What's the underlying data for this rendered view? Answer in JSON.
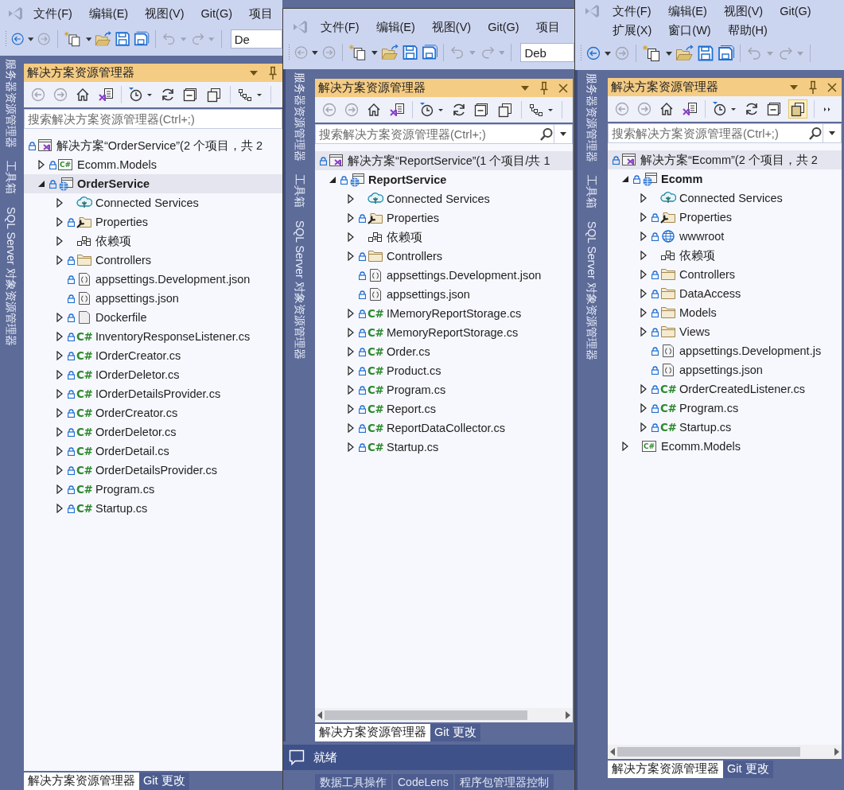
{
  "windows": [
    {
      "menu_rows": [
        [
          "文件(F)",
          "编辑(E)",
          "视图(V)",
          "Git(G)",
          "项目"
        ]
      ],
      "back_enabled": true,
      "config_combo": "De",
      "side_tabs": [
        "服务器资源管理器",
        "工具箱",
        "SQL Server 对象资源管理器"
      ],
      "explorer": {
        "title": "解决方案资源管理器",
        "closable": false,
        "toolbar": [
          {
            "kind": "back"
          },
          {
            "kind": "forward"
          },
          {
            "kind": "home"
          },
          {
            "kind": "switch-views"
          },
          {
            "kind": "sep"
          },
          {
            "kind": "pending-filter"
          },
          {
            "kind": "refresh"
          },
          {
            "kind": "collapse-all"
          },
          {
            "kind": "show-all"
          },
          {
            "kind": "sep"
          },
          {
            "kind": "hierarchy"
          },
          {
            "kind": "sep"
          }
        ],
        "show_all_files": false,
        "search_placeholder": "搜索解决方案资源管理器(Ctrl+;)",
        "search_button": false,
        "tree": [
          {
            "label": "解决方案“OrderService”(2 个项目，共 2",
            "kind": "solution",
            "locked": true,
            "selected": false,
            "children": [
              {
                "label": "Ecomm.Models",
                "kind": "csharp-project",
                "icon_text": "C#",
                "locked": true,
                "expanded": false,
                "selected": false
              },
              {
                "label": "OrderService",
                "kind": "web-project",
                "locked": true,
                "expanded": true,
                "selected": true,
                "children": [
                  {
                    "label": "Connected Services",
                    "kind": "connected",
                    "locked": false,
                    "expanded": false,
                    "selected": false
                  },
                  {
                    "label": "Properties",
                    "kind": "properties",
                    "locked": true,
                    "expanded": false,
                    "selected": false
                  },
                  {
                    "label": "依赖项",
                    "kind": "dependencies",
                    "locked": false,
                    "expanded": false,
                    "selected": false
                  },
                  {
                    "label": "Controllers",
                    "kind": "folder",
                    "locked": true,
                    "expanded": false,
                    "selected": false
                  },
                  {
                    "label": "appsettings.Development.json",
                    "kind": "json",
                    "locked": true,
                    "selected": false
                  },
                  {
                    "label": "appsettings.json",
                    "kind": "json",
                    "locked": true,
                    "selected": false
                  },
                  {
                    "label": "Dockerfile",
                    "kind": "file",
                    "locked": true,
                    "expanded": false,
                    "selected": false
                  },
                  {
                    "label": "InventoryResponseListener.cs",
                    "kind": "csharp",
                    "icon_text": "C#",
                    "locked": true,
                    "expanded": false,
                    "selected": false
                  },
                  {
                    "label": "IOrderCreator.cs",
                    "kind": "csharp",
                    "icon_text": "C#",
                    "locked": true,
                    "expanded": false,
                    "selected": false
                  },
                  {
                    "label": "IOrderDeletor.cs",
                    "kind": "csharp",
                    "icon_text": "C#",
                    "locked": true,
                    "expanded": false,
                    "selected": false
                  },
                  {
                    "label": "IOrderDetailsProvider.cs",
                    "kind": "csharp",
                    "icon_text": "C#",
                    "locked": true,
                    "expanded": false,
                    "selected": false
                  },
                  {
                    "label": "OrderCreator.cs",
                    "kind": "csharp",
                    "icon_text": "C#",
                    "locked": true,
                    "expanded": false,
                    "selected": false
                  },
                  {
                    "label": "OrderDeletor.cs",
                    "kind": "csharp",
                    "icon_text": "C#",
                    "locked": true,
                    "expanded": false,
                    "selected": false
                  },
                  {
                    "label": "OrderDetail.cs",
                    "kind": "csharp",
                    "icon_text": "C#",
                    "locked": true,
                    "expanded": false,
                    "selected": false
                  },
                  {
                    "label": "OrderDetailsProvider.cs",
                    "kind": "csharp",
                    "icon_text": "C#",
                    "locked": true,
                    "expanded": false,
                    "selected": false
                  },
                  {
                    "label": "Program.cs",
                    "kind": "csharp",
                    "icon_text": "C#",
                    "locked": true,
                    "expanded": false,
                    "selected": false
                  },
                  {
                    "label": "Startup.cs",
                    "kind": "csharp",
                    "icon_text": "C#",
                    "locked": true,
                    "expanded": false,
                    "selected": false
                  }
                ]
              }
            ]
          }
        ],
        "scrollbar": false,
        "tabs": [
          {
            "label": "解决方案资源管理器",
            "selected": true
          },
          {
            "label": "Git 更改",
            "selected": false
          }
        ]
      }
    },
    {
      "menu_rows": [
        [
          "文件(F)",
          "编辑(E)",
          "视图(V)",
          "Git(G)",
          "项目"
        ]
      ],
      "back_enabled": false,
      "config_combo": "Deb",
      "side_tabs": [
        "服务器资源管理器",
        "工具箱",
        "SQL Server 对象资源管理器"
      ],
      "explorer": {
        "title": "解决方案资源管理器",
        "closable": true,
        "toolbar": [
          {
            "kind": "back"
          },
          {
            "kind": "forward"
          },
          {
            "kind": "home"
          },
          {
            "kind": "switch-views"
          },
          {
            "kind": "sep"
          },
          {
            "kind": "pending-filter"
          },
          {
            "kind": "refresh"
          },
          {
            "kind": "collapse-all"
          },
          {
            "kind": "show-all"
          },
          {
            "kind": "sep"
          },
          {
            "kind": "hierarchy"
          },
          {
            "kind": "sep"
          }
        ],
        "show_all_files": false,
        "search_placeholder": "搜索解决方案资源管理器(Ctrl+;)",
        "search_button": true,
        "tree": [
          {
            "label": "解决方案“ReportService”(1 个项目/共 1",
            "kind": "solution",
            "locked": true,
            "selected": true,
            "children": [
              {
                "label": "ReportService",
                "kind": "web-project",
                "locked": true,
                "expanded": true,
                "selected": false,
                "children": [
                  {
                    "label": "Connected Services",
                    "kind": "connected",
                    "locked": false,
                    "expanded": false,
                    "selected": false
                  },
                  {
                    "label": "Properties",
                    "kind": "properties",
                    "locked": true,
                    "expanded": false,
                    "selected": false
                  },
                  {
                    "label": "依赖项",
                    "kind": "dependencies",
                    "locked": false,
                    "expanded": false,
                    "selected": false
                  },
                  {
                    "label": "Controllers",
                    "kind": "folder",
                    "locked": true,
                    "expanded": false,
                    "selected": false
                  },
                  {
                    "label": "appsettings.Development.json",
                    "kind": "json",
                    "locked": true,
                    "selected": false
                  },
                  {
                    "label": "appsettings.json",
                    "kind": "json",
                    "locked": true,
                    "selected": false
                  },
                  {
                    "label": "IMemoryReportStorage.cs",
                    "kind": "csharp",
                    "icon_text": "C#",
                    "locked": true,
                    "expanded": false,
                    "selected": false
                  },
                  {
                    "label": "MemoryReportStorage.cs",
                    "kind": "csharp",
                    "icon_text": "C#",
                    "locked": true,
                    "expanded": false,
                    "selected": false
                  },
                  {
                    "label": "Order.cs",
                    "kind": "csharp",
                    "icon_text": "C#",
                    "locked": true,
                    "expanded": false,
                    "selected": false
                  },
                  {
                    "label": "Product.cs",
                    "kind": "csharp",
                    "icon_text": "C#",
                    "locked": true,
                    "expanded": false,
                    "selected": false
                  },
                  {
                    "label": "Program.cs",
                    "kind": "csharp",
                    "icon_text": "C#",
                    "locked": true,
                    "expanded": false,
                    "selected": false
                  },
                  {
                    "label": "Report.cs",
                    "kind": "csharp",
                    "icon_text": "C#",
                    "locked": true,
                    "expanded": false,
                    "selected": false
                  },
                  {
                    "label": "ReportDataCollector.cs",
                    "kind": "csharp",
                    "icon_text": "C#",
                    "locked": true,
                    "expanded": false,
                    "selected": false
                  },
                  {
                    "label": "Startup.cs",
                    "kind": "csharp",
                    "icon_text": "C#",
                    "locked": true,
                    "expanded": false,
                    "selected": false
                  }
                ]
              }
            ]
          }
        ],
        "scrollbar": true,
        "tabs": [
          {
            "label": "解决方案资源管理器",
            "selected": true
          },
          {
            "label": "Git 更改",
            "selected": false
          }
        ]
      },
      "status_bar": {
        "text": "就绪"
      },
      "tool_tabs": [
        "数据工具操作",
        "CodeLens",
        "程序包管理器控制"
      ]
    },
    {
      "menu_rows": [
        [
          "文件(F)",
          "编辑(E)",
          "视图(V)",
          "Git(G)"
        ],
        [
          "扩展(X)",
          "窗口(W)",
          "帮助(H)"
        ]
      ],
      "back_enabled": true,
      "side_tabs": [
        "服务器资源管理器",
        "工具箱",
        "SQL Server 对象资源管理器"
      ],
      "explorer": {
        "title": "解决方案资源管理器",
        "closable": true,
        "toolbar": [
          {
            "kind": "back"
          },
          {
            "kind": "forward"
          },
          {
            "kind": "home"
          },
          {
            "kind": "switch-views"
          },
          {
            "kind": "sep"
          },
          {
            "kind": "pending-filter"
          },
          {
            "kind": "refresh"
          },
          {
            "kind": "collapse-all"
          },
          {
            "kind": "show-all"
          },
          {
            "kind": "sep"
          },
          {
            "kind": "overflow"
          }
        ],
        "show_all_files": true,
        "search_placeholder": "搜索解决方案资源管理器(Ctrl+;)",
        "search_button": true,
        "tree": [
          {
            "label": "解决方案“Ecomm”(2 个项目，共 2",
            "kind": "solution",
            "locked": true,
            "selected": true,
            "children": [
              {
                "label": "Ecomm",
                "kind": "web-project",
                "locked": true,
                "expanded": true,
                "selected": false,
                "children": [
                  {
                    "label": "Connected Services",
                    "kind": "connected",
                    "locked": false,
                    "expanded": false,
                    "selected": false
                  },
                  {
                    "label": "Properties",
                    "kind": "properties",
                    "locked": true,
                    "expanded": false,
                    "selected": false
                  },
                  {
                    "label": "wwwroot",
                    "kind": "globe",
                    "locked": true,
                    "expanded": false,
                    "selected": false
                  },
                  {
                    "label": "依赖项",
                    "kind": "dependencies",
                    "locked": false,
                    "expanded": false,
                    "selected": false
                  },
                  {
                    "label": "Controllers",
                    "kind": "folder",
                    "locked": true,
                    "expanded": false,
                    "selected": false
                  },
                  {
                    "label": "DataAccess",
                    "kind": "folder",
                    "locked": true,
                    "expanded": false,
                    "selected": false
                  },
                  {
                    "label": "Models",
                    "kind": "folder",
                    "locked": true,
                    "expanded": false,
                    "selected": false
                  },
                  {
                    "label": "Views",
                    "kind": "folder",
                    "locked": true,
                    "expanded": false,
                    "selected": false
                  },
                  {
                    "label": "appsettings.Development.js",
                    "kind": "json",
                    "locked": true,
                    "selected": false
                  },
                  {
                    "label": "appsettings.json",
                    "kind": "json",
                    "locked": true,
                    "selected": false
                  },
                  {
                    "label": "OrderCreatedListener.cs",
                    "kind": "csharp",
                    "icon_text": "C#",
                    "locked": true,
                    "expanded": false,
                    "selected": false
                  },
                  {
                    "label": "Program.cs",
                    "kind": "csharp",
                    "icon_text": "C#",
                    "locked": true,
                    "expanded": false,
                    "selected": false
                  },
                  {
                    "label": "Startup.cs",
                    "kind": "csharp",
                    "icon_text": "C#",
                    "locked": true,
                    "expanded": false,
                    "selected": false
                  }
                ]
              },
              {
                "label": "Ecomm.Models",
                "kind": "csharp-project",
                "icon_text": "C#",
                "locked": false,
                "expanded": false,
                "selected": false
              }
            ]
          }
        ],
        "scrollbar": true,
        "tabs": [
          {
            "label": "解决方案资源管理器",
            "selected": true
          },
          {
            "label": "Git 更改",
            "selected": false
          }
        ]
      }
    }
  ]
}
